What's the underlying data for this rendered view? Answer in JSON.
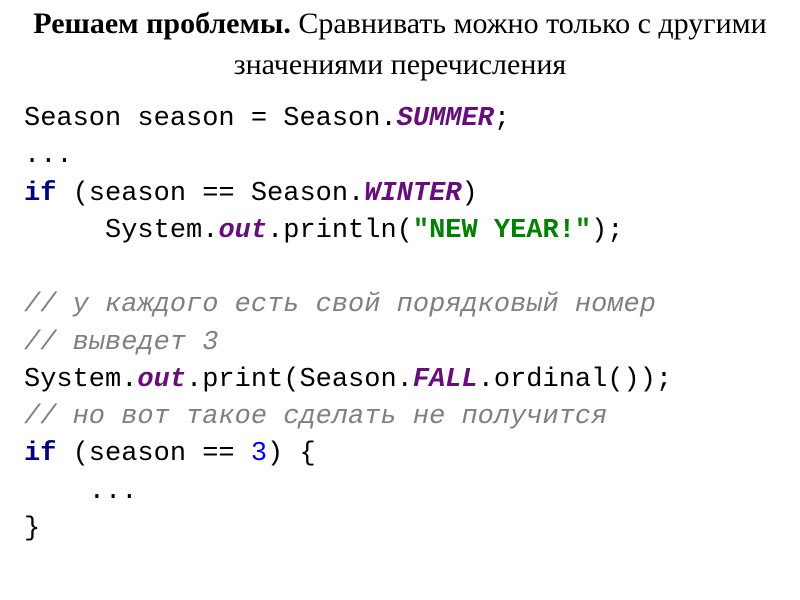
{
  "heading": {
    "bold": "Решаем проблемы.",
    "rest": " Сравнивать можно только с другими значениями перечисления"
  },
  "code": {
    "l1_a": "Season season = Season.",
    "l1_summer": "SUMMER",
    "l1_b": ";",
    "l2": "...",
    "l3_if": "if",
    "l3_a": " (season == Season.",
    "l3_winter": "WINTER",
    "l3_b": ")",
    "l4_a": "     System.",
    "l4_out": "out",
    "l4_b": ".println(",
    "l4_str": "\"NEW YEAR!\"",
    "l4_c": ");",
    "blank": " ",
    "c1": "// у каждого есть свой порядковый номер",
    "c2": "// выведет 3",
    "l7_a": "System.",
    "l7_out": "out",
    "l7_b": ".print(Season.",
    "l7_fall": "FALL",
    "l7_c": ".ordinal());",
    "c3": "// но вот такое сделать не получится",
    "l9_if": "if",
    "l9_a": " (season == ",
    "l9_num": "3",
    "l9_b": ") {",
    "l10": "    ...",
    "l11": "}"
  }
}
